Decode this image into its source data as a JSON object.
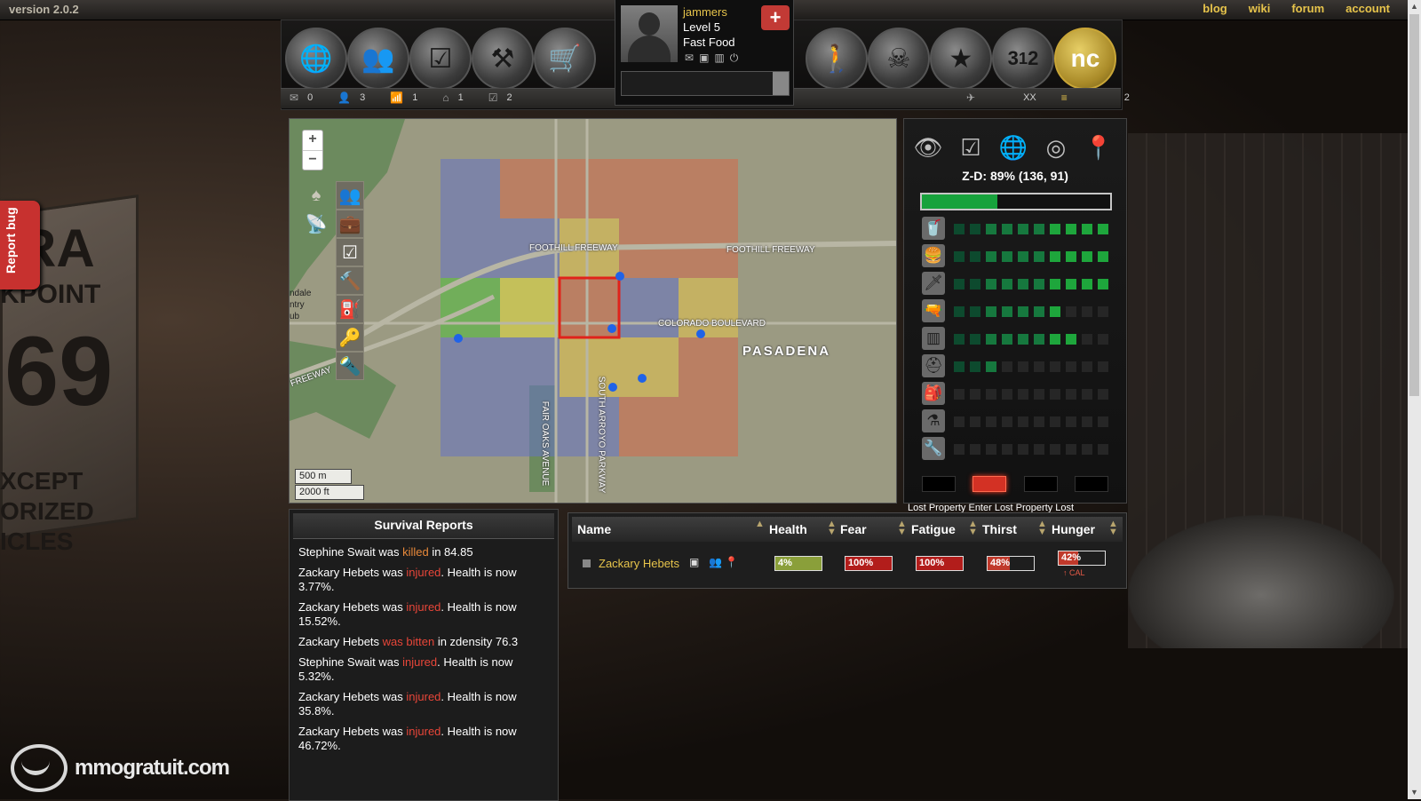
{
  "version": "version 2.0.2",
  "top_links": [
    "blog",
    "wiki",
    "forum",
    "account"
  ],
  "report_bug": "Report bug",
  "player": {
    "name": "jammers",
    "level": "Level 5",
    "job": "Fast Food"
  },
  "nav_left_icons": [
    "globe-icon",
    "survivors-icon",
    "tasks-icon",
    "build-icon",
    "shop-cart-icon"
  ],
  "nav_right_icons": [
    "walking-man-icon",
    "skull-crossbones-icon",
    "star-icon",
    "leaderboard-icon",
    "nc-coin-icon"
  ],
  "stats": {
    "mail": "0",
    "survivors": "3",
    "radio": "1",
    "houses": "1",
    "tasks": "2",
    "ranged": "XX",
    "coins": "2"
  },
  "map": {
    "zoom_in": "+",
    "zoom_out": "−",
    "scale_m": "500 m",
    "scale_ft": "2000 ft",
    "labels": {
      "foothill1": "FOOTHILL FREEWAY",
      "foothill2": "FOOTHILL FREEWAY",
      "colorado": "COLORADO BOULEVARD",
      "pasadena": "PASADENA",
      "fair_oaks": "FAIR OAKS AVENUE",
      "arroyo": "SOUTH ARROYO PARKWAY",
      "freeway_left": "FREEWAY",
      "glendale": "ndale\nntry\nub"
    }
  },
  "zd_panel": {
    "zd_text": "Z-D: 89% (136, 91)",
    "zd_fraction": 0.4,
    "skills": [
      {
        "icon": "drink-icon",
        "level": 10
      },
      {
        "icon": "food-icon",
        "level": 10
      },
      {
        "icon": "melee-icon",
        "level": 10
      },
      {
        "icon": "pistol-icon",
        "level": 7
      },
      {
        "icon": "ammo-icon",
        "level": 8
      },
      {
        "icon": "helmet-icon",
        "level": 3
      },
      {
        "icon": "backpack-icon",
        "level": 0
      },
      {
        "icon": "flask-icon",
        "level": 0
      },
      {
        "icon": "wrench-icon",
        "level": 0
      }
    ],
    "ticker": "Lost Property Enter Lost Property Lost"
  },
  "reports": {
    "title": "Survival Reports",
    "items": [
      {
        "who": "Stephine Swait was ",
        "what": "killed",
        "rest": " in 84.85",
        "style": "orange"
      },
      {
        "who": "Zackary Hebets was ",
        "what": "injured",
        "rest": ". Health is now 3.77%.",
        "style": "red"
      },
      {
        "who": "Zackary Hebets was ",
        "what": "injured",
        "rest": ". Health is now 15.52%.",
        "style": "red"
      },
      {
        "who": "Zackary Hebets ",
        "what": "was bitten",
        "rest": " in zdensity 76.3",
        "style": "red"
      },
      {
        "who": "Stephine Swait was ",
        "what": "injured",
        "rest": ". Health is now 5.32%.",
        "style": "red"
      },
      {
        "who": "Zackary Hebets was ",
        "what": "injured",
        "rest": ". Health is now 35.8%.",
        "style": "red"
      },
      {
        "who": "Zackary Hebets was ",
        "what": "injured",
        "rest": ". Health is now 46.72%.",
        "style": "red"
      }
    ]
  },
  "survivors": {
    "headers": [
      "Name",
      "Health",
      "Fear",
      "Fatigue",
      "Thirst",
      "Hunger"
    ],
    "row": {
      "name": "Zackary Hebets",
      "health": {
        "text": "4%",
        "value": 4,
        "color": "#8a9f3a"
      },
      "fear": {
        "text": "100%",
        "value": 100,
        "color": "#b21d1b"
      },
      "fatigue": {
        "text": "100%",
        "value": 100,
        "color": "#b21d1b"
      },
      "thirst": {
        "text": "48%",
        "value": 48,
        "color": "#c0392b"
      },
      "hunger": {
        "text": "42%",
        "value": 42,
        "color": "#c0392b"
      },
      "cal_note": "CAL"
    }
  },
  "watermark": "mmogratuit.com",
  "colors": {
    "accent": "#e7c44b",
    "alert": "#e84639"
  }
}
